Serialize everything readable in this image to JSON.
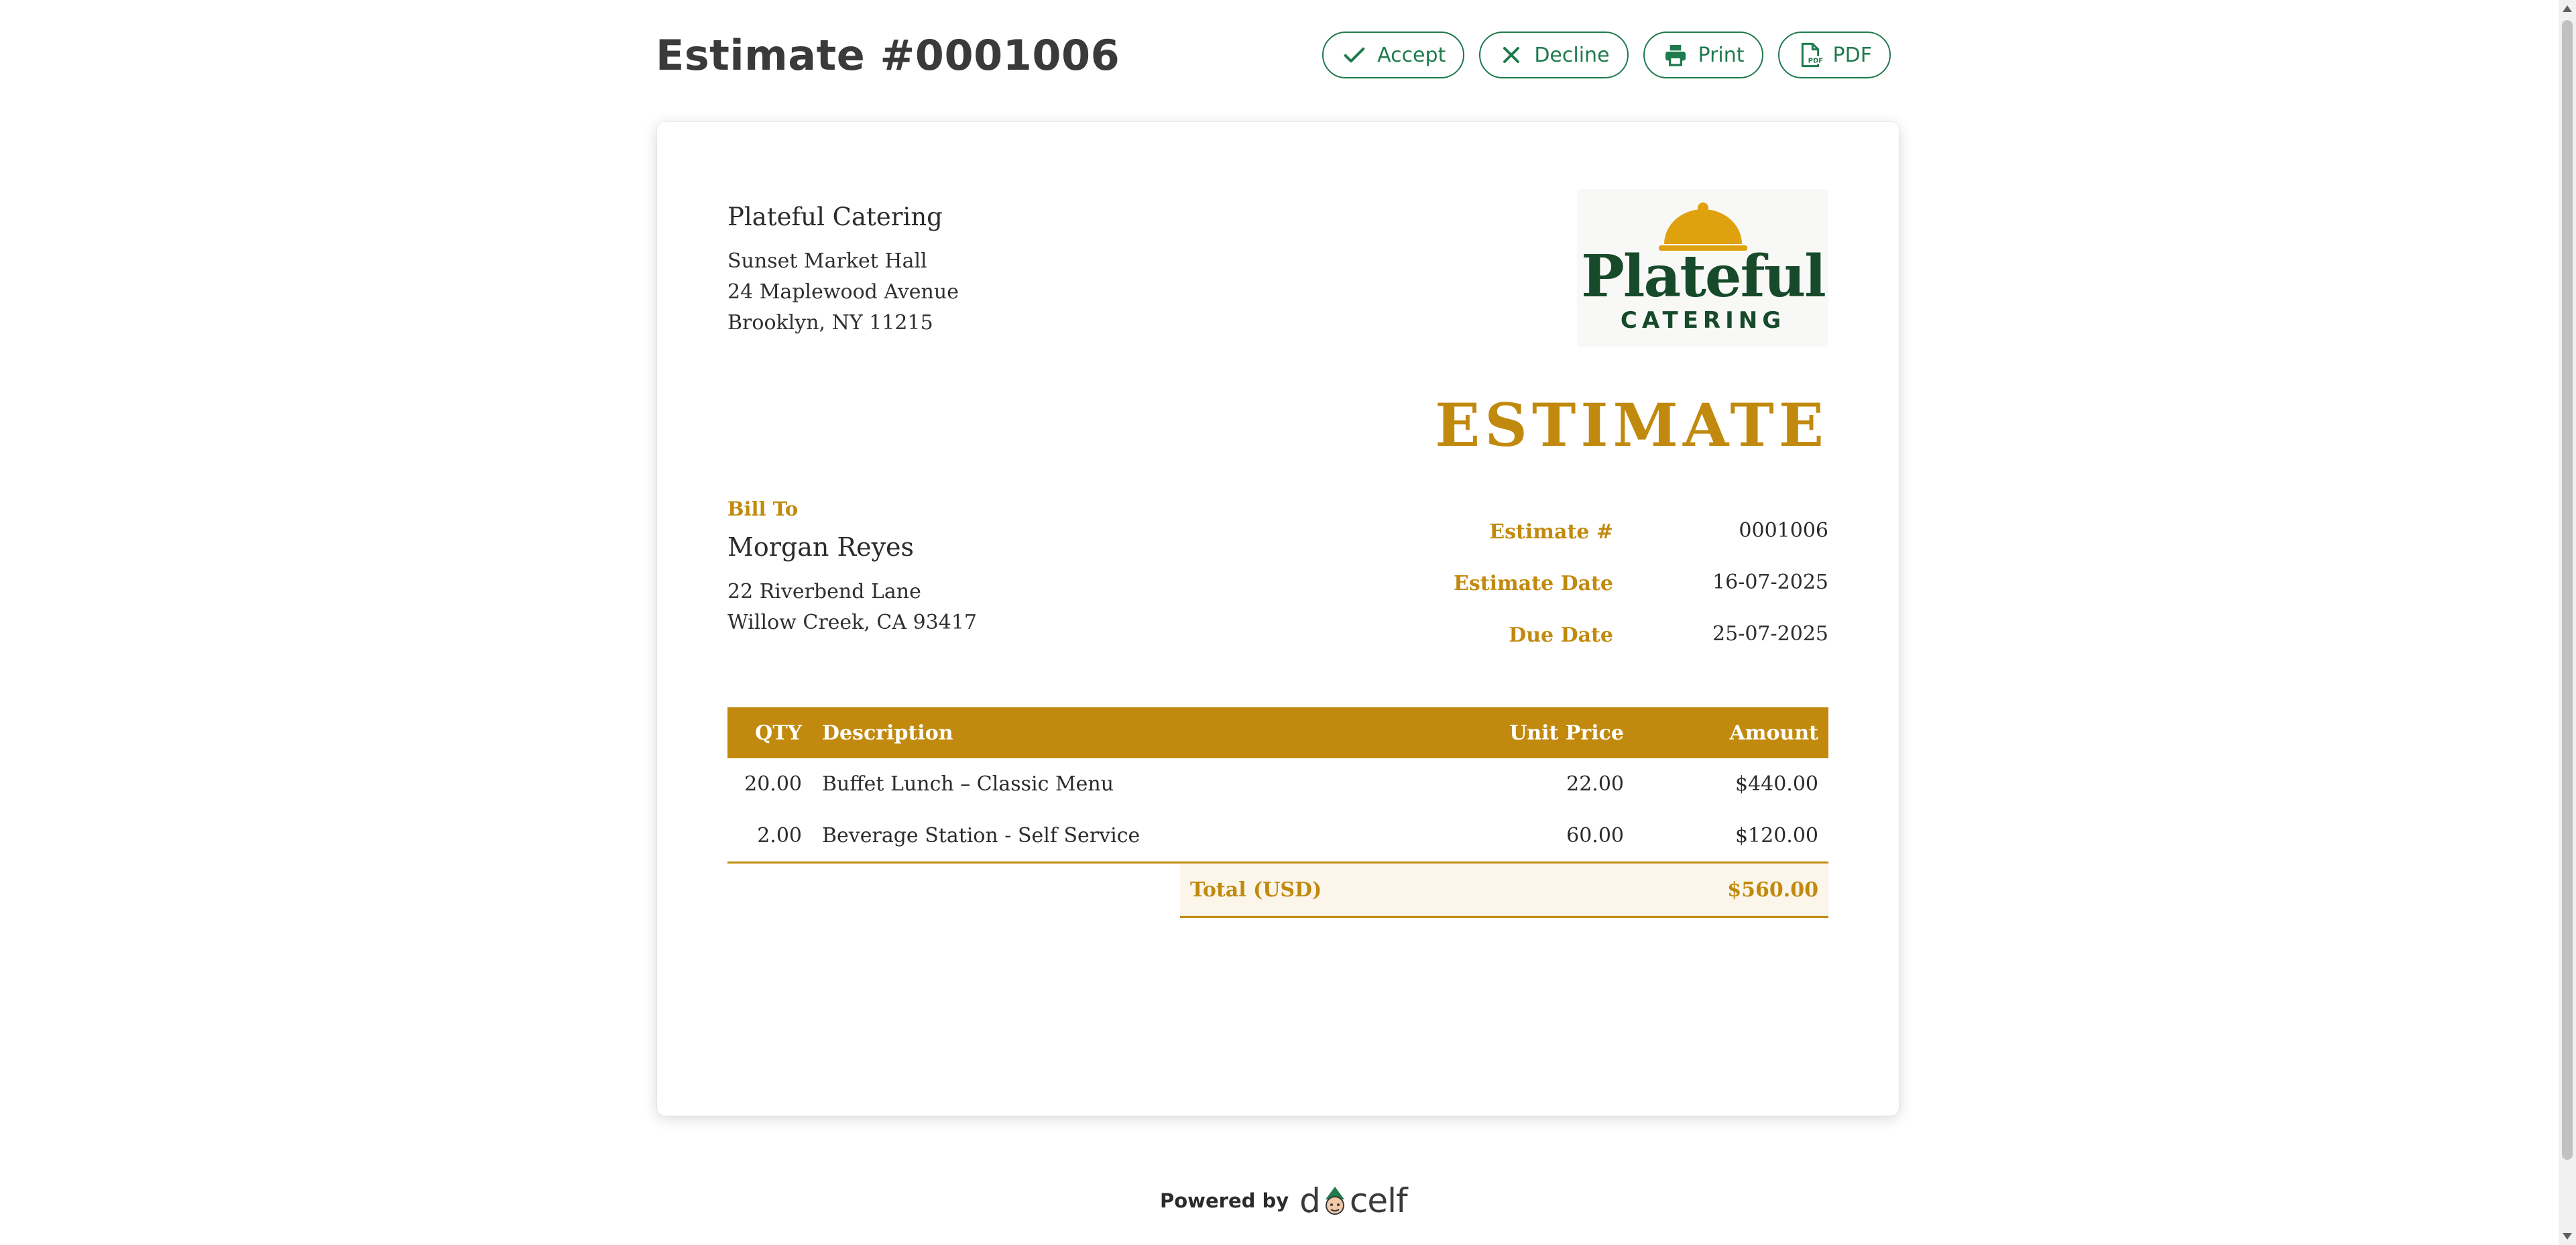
{
  "header": {
    "title": "Estimate #0001006",
    "actions": [
      {
        "label": "Accept",
        "icon": "check-icon"
      },
      {
        "label": "Decline",
        "icon": "close-icon"
      },
      {
        "label": "Print",
        "icon": "printer-icon"
      },
      {
        "label": "PDF",
        "icon": "pdf-file-icon"
      }
    ],
    "accent_color": "#1f7a4d"
  },
  "document": {
    "company": {
      "name": "Plateful Catering",
      "address": [
        "Sunset Market Hall",
        "24 Maplewood Avenue",
        "Brooklyn, NY 11215"
      ]
    },
    "logo": {
      "text_main": "Plateful",
      "text_sub": "CATERING",
      "icon": "cloche-icon"
    },
    "heading": "ESTIMATE",
    "bill_to": {
      "label": "Bill To",
      "name": "Morgan Reyes",
      "address": [
        "22 Riverbend Lane",
        "Willow Creek, CA 93417"
      ]
    },
    "meta": [
      {
        "label": "Estimate #",
        "value": "0001006"
      },
      {
        "label": "Estimate Date",
        "value": "16-07-2025"
      },
      {
        "label": "Due Date",
        "value": "25-07-2025"
      }
    ],
    "table": {
      "columns": [
        "QTY",
        "Description",
        "Unit Price",
        "Amount"
      ],
      "rows": [
        {
          "qty": "20.00",
          "description": "Buffet Lunch – Classic Menu",
          "unit_price": "22.00",
          "amount": "$440.00"
        },
        {
          "qty": "2.00",
          "description": "Beverage Station - Self Service",
          "unit_price": "60.00",
          "amount": "$120.00"
        }
      ]
    },
    "total": {
      "label": "Total (USD)",
      "value": "$560.00"
    },
    "accent_color": "#c18a0e"
  },
  "footer": {
    "powered_by": "Powered by",
    "brand": "docelf"
  }
}
